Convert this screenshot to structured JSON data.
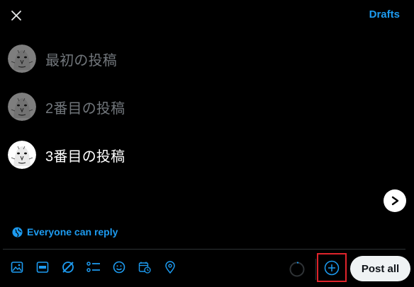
{
  "header": {
    "close_icon": "close-icon",
    "drafts_label": "Drafts"
  },
  "thread": {
    "posts": [
      {
        "text": "最初の投稿",
        "state": "inactive"
      },
      {
        "text": "2番目の投稿",
        "state": "inactive"
      },
      {
        "text": "3番目の投稿",
        "state": "active"
      }
    ]
  },
  "reply_setting": {
    "icon": "globe-icon",
    "label": "Everyone can reply"
  },
  "toolbar": {
    "tools": [
      "image-icon",
      "gif-icon",
      "grok-icon",
      "poll-icon",
      "emoji-icon",
      "schedule-icon",
      "location-icon"
    ],
    "add_post_icon": "add-post-icon",
    "post_all_label": "Post all"
  },
  "colors": {
    "accent": "#1d9bf0",
    "background": "#000000",
    "muted_text": "#71767b",
    "highlight_border": "#e0242b"
  }
}
